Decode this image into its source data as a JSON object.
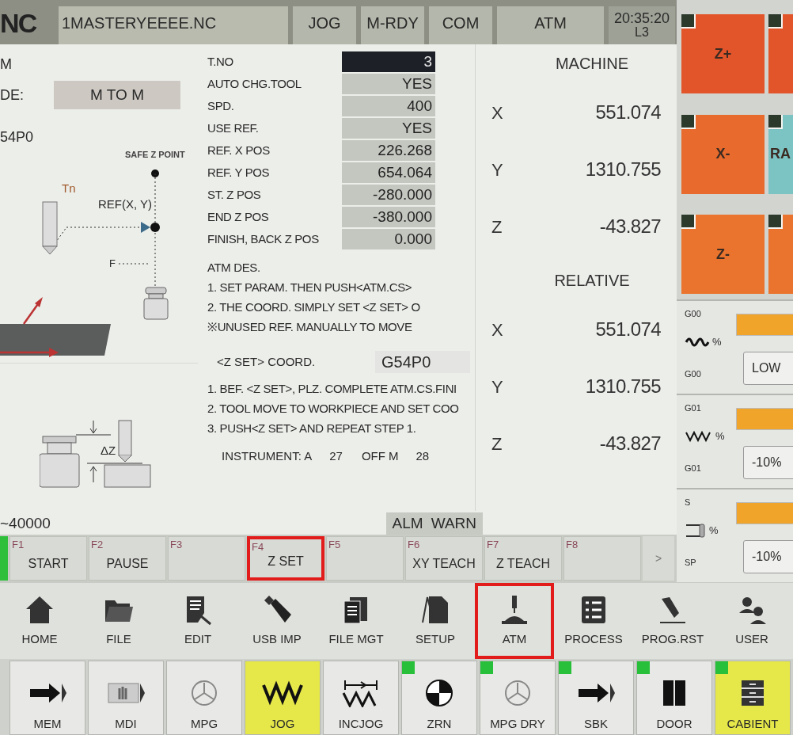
{
  "header": {
    "logo": "NC",
    "file": "1MASTERYEEEE.NC",
    "status": [
      "JOG",
      "M-RDY",
      "COM",
      "ATM"
    ],
    "time": "20:35:20",
    "line": "L3"
  },
  "left": {
    "mode_letter": "M",
    "mode_label": "DE:",
    "mode_value": "M TO M",
    "coord": "54P0",
    "safe": "SAFE Z POINT",
    "tool": "Tn",
    "ref": "REF(X, Y)",
    "feed": "F",
    "delta": "ΔZ"
  },
  "params": [
    {
      "label": "T.NO",
      "value": "3",
      "selected": true
    },
    {
      "label": "AUTO CHG.TOOL",
      "value": "YES",
      "selected": false
    },
    {
      "label": "SPD.",
      "value": "400",
      "selected": false
    },
    {
      "label": "USE REF.",
      "value": "YES",
      "selected": false
    },
    {
      "label": "REF. X POS",
      "value": "226.268",
      "selected": false
    },
    {
      "label": "REF. Y POS",
      "value": "654.064",
      "selected": false
    },
    {
      "label": "ST. Z POS",
      "value": "-280.000",
      "selected": false
    },
    {
      "label": "END Z POS",
      "value": "-380.000",
      "selected": false
    },
    {
      "label": "FINISH, BACK Z POS",
      "value": "0.000",
      "selected": false
    }
  ],
  "atm_des": {
    "title": "ATM DES.",
    "lines": [
      "1. SET PARAM. THEN PUSH<ATM.CS>",
      "2. THE COORD. SIMPLY SET <Z SET> O",
      "※UNUSED REF. MANUALLY TO MOVE"
    ]
  },
  "zset": {
    "label": "<Z SET> COORD.",
    "value": "G54P0",
    "steps": [
      "1. BEF. <Z SET>, PLZ. COMPLETE ATM.CS.FINI",
      "2. TOOL MOVE TO WORKPIECE AND SET COO",
      "3. PUSH<Z SET> AND REPEAT STEP 1."
    ],
    "instrument": [
      {
        "label": "INSTRUMENT: A",
        "value": "27"
      },
      {
        "label": "OFF M",
        "value": "28"
      }
    ]
  },
  "machine": {
    "title": "MACHINE",
    "axes": [
      {
        "axis": "X",
        "value": "551.074"
      },
      {
        "axis": "Y",
        "value": "1310.755"
      },
      {
        "axis": "Z",
        "value": "-43.827"
      }
    ]
  },
  "relative": {
    "title": "RELATIVE",
    "axes": [
      {
        "axis": "X",
        "value": "551.074"
      },
      {
        "axis": "Y",
        "value": "1310.755"
      },
      {
        "axis": "Z",
        "value": "-43.827"
      }
    ]
  },
  "status": {
    "spindle": "~40000",
    "alarms": [
      "ALM",
      "WARN"
    ]
  },
  "fkeys": [
    {
      "key": "F1",
      "label": "START",
      "annotated": false
    },
    {
      "key": "F2",
      "label": "PAUSE",
      "annotated": false
    },
    {
      "key": "F3",
      "annotated": false
    },
    {
      "key": "F4",
      "label": "Z SET",
      "annotated": true
    },
    {
      "key": "F5",
      "annotated": false
    },
    {
      "key": "F6",
      "label": "XY TEACH",
      "annotated": false
    },
    {
      "key": "F7",
      "label": "Z TEACH",
      "annotated": false
    },
    {
      "key": "F8",
      "annotated": false
    }
  ],
  "fkeys_more": ">",
  "jog_tiles": [
    {
      "label": "Z+",
      "color": "#e2552a",
      "indicator": true
    },
    {
      "color": "#e2552a",
      "indicator": true
    },
    {
      "label": "X-",
      "color": "#e86a2c",
      "indicator": true
    },
    {
      "label": "RA",
      "color": "#7cc4c4",
      "indicator": true
    },
    {
      "label": "Z-",
      "color": "#ea742e",
      "indicator": true
    },
    {
      "color": "#ea742e",
      "indicator": true
    }
  ],
  "overrides": [
    {
      "top": "G00",
      "kind": "rapid",
      "unit": "%",
      "bottom": "G00",
      "button": "LOW"
    },
    {
      "top": "G01",
      "kind": "feed",
      "unit": "%",
      "bottom": "G01",
      "button": "-10%"
    },
    {
      "top": "S",
      "kind": "spindle",
      "unit": "%",
      "bottom": "SP",
      "button": "-10%"
    }
  ],
  "functions": [
    {
      "label": "HOME",
      "kind": "home",
      "annotated": false
    },
    {
      "label": "FILE",
      "kind": "folder",
      "annotated": false
    },
    {
      "label": "EDIT",
      "kind": "edit",
      "annotated": false
    },
    {
      "label": "USB IMP",
      "kind": "usb",
      "annotated": false
    },
    {
      "label": "FILE MGT",
      "kind": "files",
      "annotated": false
    },
    {
      "label": "SETUP",
      "kind": "setup",
      "annotated": false
    },
    {
      "label": "ATM",
      "kind": "atm",
      "annotated": true
    },
    {
      "label": "PROCESS",
      "kind": "process",
      "annotated": false
    },
    {
      "label": "PROG.RST",
      "kind": "pen",
      "annotated": false
    },
    {
      "label": "USER",
      "kind": "user",
      "annotated": false
    }
  ],
  "modes": [
    {
      "label": "MEM",
      "kind": "arrow",
      "selected": false,
      "indicator": false
    },
    {
      "label": "MDI",
      "kind": "hand",
      "selected": false,
      "indicator": false
    },
    {
      "label": "MPG",
      "kind": "wheel",
      "selected": false,
      "indicator": false
    },
    {
      "label": "JOG",
      "kind": "zigzag",
      "selected": true,
      "indicator": false
    },
    {
      "label": "INCJOG",
      "kind": "inc",
      "selected": false,
      "indicator": false
    },
    {
      "label": "ZRN",
      "kind": "zrn",
      "selected": false,
      "indicator": true
    },
    {
      "label": "MPG DRY",
      "kind": "wheel",
      "selected": false,
      "indicator": true
    },
    {
      "label": "SBK",
      "kind": "arrow",
      "selected": false,
      "indicator": true
    },
    {
      "label": "DOOR",
      "kind": "door",
      "selected": false,
      "indicator": true
    },
    {
      "label": "CABIENT",
      "kind": "cabinet",
      "selected": true,
      "indicator": true
    }
  ]
}
